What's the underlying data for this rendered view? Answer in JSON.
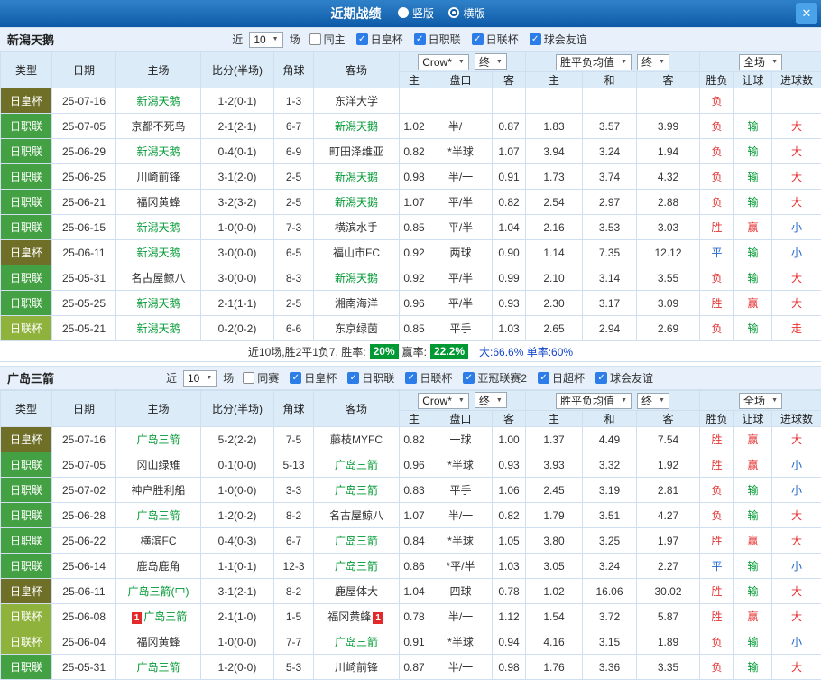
{
  "titlebar": {
    "title": "近期战绩",
    "radios": [
      {
        "label": "竖版",
        "selected": false
      },
      {
        "label": "横版",
        "selected": true
      }
    ],
    "close_glyph": "✕"
  },
  "table_header": {
    "row1": [
      "类型",
      "日期",
      "主场",
      "比分(半场)",
      "角球",
      "客场"
    ],
    "row2": [
      "主",
      "盘口",
      "客",
      "主",
      "和",
      "客",
      "胜负",
      "让球",
      "进球数"
    ],
    "odds_company": "Crow*",
    "final_label": "终",
    "avg_label": "胜平负均值",
    "scope_label": "全场"
  },
  "colors": {
    "team_green": "#009933"
  },
  "type_colors": {
    "日皇杯": "#6f6f28",
    "日职联": "#43a143",
    "日联杯": "#8fb23c"
  },
  "result_colors": {
    "red": "#e63333",
    "green": "#009933",
    "blue": "#2266cc"
  },
  "sections": [
    {
      "team": "新潟天鹅",
      "filter": {
        "prefix": "近",
        "count": "10",
        "suffix": "场",
        "checks": [
          {
            "label": "同主",
            "checked": false
          },
          {
            "label": "日皇杯",
            "checked": true
          },
          {
            "label": "日职联",
            "checked": true
          },
          {
            "label": "日联杯",
            "checked": true
          },
          {
            "label": "球会友谊",
            "checked": true
          }
        ]
      },
      "rows": [
        {
          "type": "日皇杯",
          "date": "25-07-16",
          "home": "新潟天鹅",
          "home_sel": true,
          "home_card": "",
          "score": "1-2(0-1)",
          "corners": "1-3",
          "away": "东洋大学",
          "away_sel": false,
          "away_card": "",
          "o_home": "",
          "o_hcp": "",
          "o_away": "",
          "a_home": "",
          "a_draw": "",
          "a_away": "",
          "r_wdl": "负",
          "r_wdl_c": "red",
          "r_hcp": "",
          "r_hcp_c": "green",
          "r_ou": "",
          "r_ou_c": "red"
        },
        {
          "type": "日职联",
          "date": "25-07-05",
          "home": "京都不死鸟",
          "home_sel": false,
          "home_card": "",
          "score": "2-1(2-1)",
          "corners": "6-7",
          "away": "新潟天鹅",
          "away_sel": true,
          "away_card": "",
          "o_home": "1.02",
          "o_hcp": "半/一",
          "o_away": "0.87",
          "a_home": "1.83",
          "a_draw": "3.57",
          "a_away": "3.99",
          "r_wdl": "负",
          "r_wdl_c": "red",
          "r_hcp": "输",
          "r_hcp_c": "green",
          "r_ou": "大",
          "r_ou_c": "red"
        },
        {
          "type": "日职联",
          "date": "25-06-29",
          "home": "新潟天鹅",
          "home_sel": true,
          "home_card": "",
          "score": "0-4(0-1)",
          "corners": "6-9",
          "away": "町田泽维亚",
          "away_sel": false,
          "away_card": "",
          "o_home": "0.82",
          "o_hcp": "*半球",
          "o_away": "1.07",
          "a_home": "3.94",
          "a_draw": "3.24",
          "a_away": "1.94",
          "r_wdl": "负",
          "r_wdl_c": "red",
          "r_hcp": "输",
          "r_hcp_c": "green",
          "r_ou": "大",
          "r_ou_c": "red"
        },
        {
          "type": "日职联",
          "date": "25-06-25",
          "home": "川崎前锋",
          "home_sel": false,
          "home_card": "",
          "score": "3-1(2-0)",
          "corners": "2-5",
          "away": "新潟天鹅",
          "away_sel": true,
          "away_card": "",
          "o_home": "0.98",
          "o_hcp": "半/一",
          "o_away": "0.91",
          "a_home": "1.73",
          "a_draw": "3.74",
          "a_away": "4.32",
          "r_wdl": "负",
          "r_wdl_c": "red",
          "r_hcp": "输",
          "r_hcp_c": "green",
          "r_ou": "大",
          "r_ou_c": "red"
        },
        {
          "type": "日职联",
          "date": "25-06-21",
          "home": "福冈黄蜂",
          "home_sel": false,
          "home_card": "",
          "score": "3-2(3-2)",
          "corners": "2-5",
          "away": "新潟天鹅",
          "away_sel": true,
          "away_card": "",
          "o_home": "1.07",
          "o_hcp": "平/半",
          "o_away": "0.82",
          "a_home": "2.54",
          "a_draw": "2.97",
          "a_away": "2.88",
          "r_wdl": "负",
          "r_wdl_c": "red",
          "r_hcp": "输",
          "r_hcp_c": "green",
          "r_ou": "大",
          "r_ou_c": "red"
        },
        {
          "type": "日职联",
          "date": "25-06-15",
          "home": "新潟天鹅",
          "home_sel": true,
          "home_card": "",
          "score": "1-0(0-0)",
          "corners": "7-3",
          "away": "横滨水手",
          "away_sel": false,
          "away_card": "",
          "o_home": "0.85",
          "o_hcp": "平/半",
          "o_away": "1.04",
          "a_home": "2.16",
          "a_draw": "3.53",
          "a_away": "3.03",
          "r_wdl": "胜",
          "r_wdl_c": "red",
          "r_hcp": "赢",
          "r_hcp_c": "red",
          "r_ou": "小",
          "r_ou_c": "blue"
        },
        {
          "type": "日皇杯",
          "date": "25-06-11",
          "home": "新潟天鹅",
          "home_sel": true,
          "home_card": "",
          "score": "3-0(0-0)",
          "corners": "6-5",
          "away": "福山市FC",
          "away_sel": false,
          "away_card": "",
          "o_home": "0.92",
          "o_hcp": "两球",
          "o_away": "0.90",
          "a_home": "1.14",
          "a_draw": "7.35",
          "a_away": "12.12",
          "r_wdl": "平",
          "r_wdl_c": "blue",
          "r_hcp": "输",
          "r_hcp_c": "green",
          "r_ou": "小",
          "r_ou_c": "blue"
        },
        {
          "type": "日职联",
          "date": "25-05-31",
          "home": "名古屋鲸八",
          "home_sel": false,
          "home_card": "",
          "score": "3-0(0-0)",
          "corners": "8-3",
          "away": "新潟天鹅",
          "away_sel": true,
          "away_card": "",
          "o_home": "0.92",
          "o_hcp": "平/半",
          "o_away": "0.99",
          "a_home": "2.10",
          "a_draw": "3.14",
          "a_away": "3.55",
          "r_wdl": "负",
          "r_wdl_c": "red",
          "r_hcp": "输",
          "r_hcp_c": "green",
          "r_ou": "大",
          "r_ou_c": "red"
        },
        {
          "type": "日职联",
          "date": "25-05-25",
          "home": "新潟天鹅",
          "home_sel": true,
          "home_card": "",
          "score": "2-1(1-1)",
          "corners": "2-5",
          "away": "湘南海洋",
          "away_sel": false,
          "away_card": "",
          "o_home": "0.96",
          "o_hcp": "平/半",
          "o_away": "0.93",
          "a_home": "2.30",
          "a_draw": "3.17",
          "a_away": "3.09",
          "r_wdl": "胜",
          "r_wdl_c": "red",
          "r_hcp": "赢",
          "r_hcp_c": "red",
          "r_ou": "大",
          "r_ou_c": "red"
        },
        {
          "type": "日联杯",
          "date": "25-05-21",
          "home": "新潟天鹅",
          "home_sel": true,
          "home_card": "",
          "score": "0-2(0-2)",
          "corners": "6-6",
          "away": "东京绿茵",
          "away_sel": false,
          "away_card": "",
          "o_home": "0.85",
          "o_hcp": "平手",
          "o_away": "1.03",
          "a_home": "2.65",
          "a_draw": "2.94",
          "a_away": "2.69",
          "r_wdl": "负",
          "r_wdl_c": "red",
          "r_hcp": "输",
          "r_hcp_c": "green",
          "r_ou": "走",
          "r_ou_c": "red"
        }
      ],
      "summary": {
        "prefix": "近10场,胜2平1负7, 胜率:",
        "win_rate": "20%",
        "mid": "赢率:",
        "hcp_rate": "22.2%",
        "tail": "大:66.6%  单率:60%"
      }
    },
    {
      "team": "广岛三箭",
      "filter": {
        "prefix": "近",
        "count": "10",
        "suffix": "场",
        "checks": [
          {
            "label": "同赛",
            "checked": false
          },
          {
            "label": "日皇杯",
            "checked": true
          },
          {
            "label": "日职联",
            "checked": true
          },
          {
            "label": "日联杯",
            "checked": true
          },
          {
            "label": "亚冠联赛2",
            "checked": true
          },
          {
            "label": "日超杯",
            "checked": true
          },
          {
            "label": "球会友谊",
            "checked": true
          }
        ]
      },
      "rows": [
        {
          "type": "日皇杯",
          "date": "25-07-16",
          "home": "广岛三箭",
          "home_sel": true,
          "home_card": "",
          "score": "5-2(2-2)",
          "corners": "7-5",
          "away": "藤枝MYFC",
          "away_sel": false,
          "away_card": "",
          "o_home": "0.82",
          "o_hcp": "一球",
          "o_away": "1.00",
          "a_home": "1.37",
          "a_draw": "4.49",
          "a_away": "7.54",
          "r_wdl": "胜",
          "r_wdl_c": "red",
          "r_hcp": "赢",
          "r_hcp_c": "red",
          "r_ou": "大",
          "r_ou_c": "red"
        },
        {
          "type": "日职联",
          "date": "25-07-05",
          "home": "冈山绿雉",
          "home_sel": false,
          "home_card": "",
          "score": "0-1(0-0)",
          "corners": "5-13",
          "away": "广岛三箭",
          "away_sel": true,
          "away_card": "",
          "o_home": "0.96",
          "o_hcp": "*半球",
          "o_away": "0.93",
          "a_home": "3.93",
          "a_draw": "3.32",
          "a_away": "1.92",
          "r_wdl": "胜",
          "r_wdl_c": "red",
          "r_hcp": "赢",
          "r_hcp_c": "red",
          "r_ou": "小",
          "r_ou_c": "blue"
        },
        {
          "type": "日职联",
          "date": "25-07-02",
          "home": "神户胜利船",
          "home_sel": false,
          "home_card": "",
          "score": "1-0(0-0)",
          "corners": "3-3",
          "away": "广岛三箭",
          "away_sel": true,
          "away_card": "",
          "o_home": "0.83",
          "o_hcp": "平手",
          "o_away": "1.06",
          "a_home": "2.45",
          "a_draw": "3.19",
          "a_away": "2.81",
          "r_wdl": "负",
          "r_wdl_c": "red",
          "r_hcp": "输",
          "r_hcp_c": "green",
          "r_ou": "小",
          "r_ou_c": "blue"
        },
        {
          "type": "日职联",
          "date": "25-06-28",
          "home": "广岛三箭",
          "home_sel": true,
          "home_card": "",
          "score": "1-2(0-2)",
          "corners": "8-2",
          "away": "名古屋鲸八",
          "away_sel": false,
          "away_card": "",
          "o_home": "1.07",
          "o_hcp": "半/一",
          "o_away": "0.82",
          "a_home": "1.79",
          "a_draw": "3.51",
          "a_away": "4.27",
          "r_wdl": "负",
          "r_wdl_c": "red",
          "r_hcp": "输",
          "r_hcp_c": "green",
          "r_ou": "大",
          "r_ou_c": "red"
        },
        {
          "type": "日职联",
          "date": "25-06-22",
          "home": "横滨FC",
          "home_sel": false,
          "home_card": "",
          "score": "0-4(0-3)",
          "corners": "6-7",
          "away": "广岛三箭",
          "away_sel": true,
          "away_card": "",
          "o_home": "0.84",
          "o_hcp": "*半球",
          "o_away": "1.05",
          "a_home": "3.80",
          "a_draw": "3.25",
          "a_away": "1.97",
          "r_wdl": "胜",
          "r_wdl_c": "red",
          "r_hcp": "赢",
          "r_hcp_c": "red",
          "r_ou": "大",
          "r_ou_c": "red"
        },
        {
          "type": "日职联",
          "date": "25-06-14",
          "home": "鹿岛鹿角",
          "home_sel": false,
          "home_card": "",
          "score": "1-1(0-1)",
          "corners": "12-3",
          "away": "广岛三箭",
          "away_sel": true,
          "away_card": "",
          "o_home": "0.86",
          "o_hcp": "*平/半",
          "o_away": "1.03",
          "a_home": "3.05",
          "a_draw": "3.24",
          "a_away": "2.27",
          "r_wdl": "平",
          "r_wdl_c": "blue",
          "r_hcp": "输",
          "r_hcp_c": "green",
          "r_ou": "小",
          "r_ou_c": "blue"
        },
        {
          "type": "日皇杯",
          "date": "25-06-11",
          "home": "广岛三箭(中)",
          "home_sel": true,
          "home_card": "",
          "score": "3-1(2-1)",
          "corners": "8-2",
          "away": "鹿屋体大",
          "away_sel": false,
          "away_card": "",
          "o_home": "1.04",
          "o_hcp": "四球",
          "o_away": "0.78",
          "a_home": "1.02",
          "a_draw": "16.06",
          "a_away": "30.02",
          "r_wdl": "胜",
          "r_wdl_c": "red",
          "r_hcp": "输",
          "r_hcp_c": "green",
          "r_ou": "大",
          "r_ou_c": "red"
        },
        {
          "type": "日联杯",
          "date": "25-06-08",
          "home": "广岛三箭",
          "home_sel": true,
          "home_card": "1",
          "score": "2-1(1-0)",
          "corners": "1-5",
          "away": "福冈黄蜂",
          "away_sel": false,
          "away_card": "1",
          "o_home": "0.78",
          "o_hcp": "半/一",
          "o_away": "1.12",
          "a_home": "1.54",
          "a_draw": "3.72",
          "a_away": "5.87",
          "r_wdl": "胜",
          "r_wdl_c": "red",
          "r_hcp": "赢",
          "r_hcp_c": "red",
          "r_ou": "大",
          "r_ou_c": "red"
        },
        {
          "type": "日联杯",
          "date": "25-06-04",
          "home": "福冈黄蜂",
          "home_sel": false,
          "home_card": "",
          "score": "1-0(0-0)",
          "corners": "7-7",
          "away": "广岛三箭",
          "away_sel": true,
          "away_card": "",
          "o_home": "0.91",
          "o_hcp": "*半球",
          "o_away": "0.94",
          "a_home": "4.16",
          "a_draw": "3.15",
          "a_away": "1.89",
          "r_wdl": "负",
          "r_wdl_c": "red",
          "r_hcp": "输",
          "r_hcp_c": "green",
          "r_ou": "小",
          "r_ou_c": "blue"
        },
        {
          "type": "日职联",
          "date": "25-05-31",
          "home": "广岛三箭",
          "home_sel": true,
          "home_card": "",
          "score": "1-2(0-0)",
          "corners": "5-3",
          "away": "川崎前锋",
          "away_sel": false,
          "away_card": "",
          "o_home": "0.87",
          "o_hcp": "半/一",
          "o_away": "0.98",
          "a_home": "1.76",
          "a_draw": "3.36",
          "a_away": "3.35",
          "r_wdl": "负",
          "r_wdl_c": "red",
          "r_hcp": "输",
          "r_hcp_c": "green",
          "r_ou": "大",
          "r_ou_c": "red"
        }
      ],
      "summary": null
    }
  ]
}
